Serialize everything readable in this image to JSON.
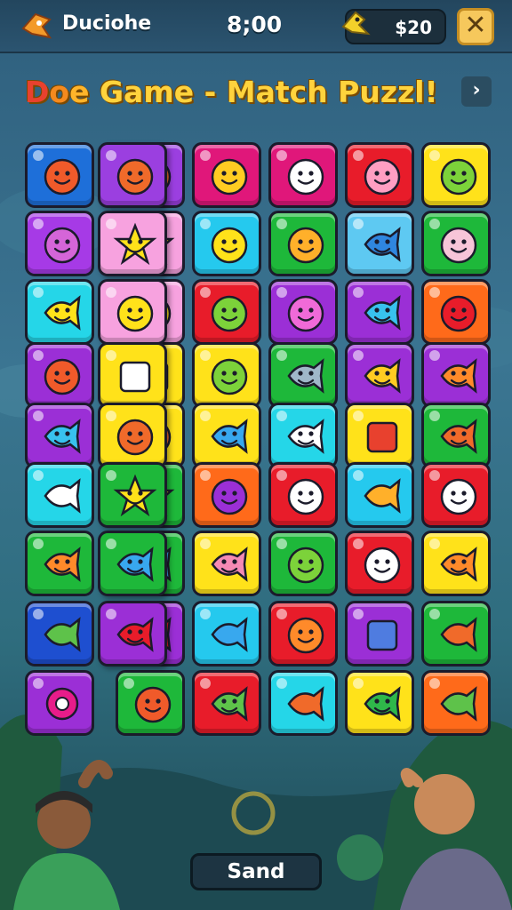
{
  "header": {
    "app_title": "Duciohe",
    "timer": "8;00",
    "coins": "$20",
    "close_label": "✕"
  },
  "banner": {
    "title_prefix_letters": [
      "D",
      "o",
      "e"
    ],
    "title_rest": " Game - Match Puzzl!",
    "next_label": "›"
  },
  "board": {
    "tiles": [
      {
        "color": "#1e6fd9",
        "face": "#f05a2a",
        "icon": "orange-face-icon"
      },
      {
        "color": "#9b3fe0",
        "face": "#f06a2a",
        "icon": "orange-blob-icon"
      },
      {
        "color": "#e0177a",
        "face": "#ffcc22",
        "icon": "yellow-face-icon"
      },
      {
        "color": "#e0177a",
        "face": "#ffffff",
        "icon": "white-face-icon"
      },
      {
        "color": "#e81c2a",
        "face": "#ff9ec2",
        "icon": "pink-face-icon"
      },
      {
        "color": "#ffe21a",
        "face": "#7cd23a",
        "icon": "green-face-icon"
      },
      {
        "color": "#a63ae6",
        "face": "#d565d8",
        "icon": "purple-cat-icon"
      },
      {
        "color": "#f7a2df",
        "face": "#ffe21a",
        "icon": "yellow-star-icon"
      },
      {
        "color": "#25c9ee",
        "face": "#ffe21a",
        "icon": "lemon-icon"
      },
      {
        "color": "#1eb83a",
        "face": "#ffb02a",
        "icon": "orange-swirl-icon"
      },
      {
        "color": "#5ec9f2",
        "face": "#2f86df",
        "icon": "blue-fish-icon"
      },
      {
        "color": "#1eb83a",
        "face": "#f7c5d8",
        "icon": "pink-squid-icon"
      },
      {
        "color": "#25d6e8",
        "face": "#ffe21a",
        "icon": "yellow-bird-icon"
      },
      {
        "color": "#f7a2df",
        "face": "#ffe21a",
        "icon": "yellow-cat-icon"
      },
      {
        "color": "#e81c2a",
        "face": "#7cd23a",
        "icon": "green-face-icon"
      },
      {
        "color": "#9b2fd6",
        "face": "#f06ad8",
        "icon": "pink-heart-icon"
      },
      {
        "color": "#9b2fd6",
        "face": "#38c2ee",
        "icon": "cyan-fish-icon"
      },
      {
        "color": "#ff6a1a",
        "face": "#e81c2a",
        "icon": "red-mushroom-icon"
      },
      {
        "color": "#9b2fd6",
        "face": "#f05a2a",
        "icon": "orange-crab-icon"
      },
      {
        "color": "#ffe21a",
        "face": "#ffffff",
        "icon": "castle-icon"
      },
      {
        "color": "#ffe21a",
        "face": "#7cd23a",
        "icon": "green-drop-icon"
      },
      {
        "color": "#1eb83a",
        "face": "#9fb7c9",
        "icon": "grey-fish-icon"
      },
      {
        "color": "#9b2fd6",
        "face": "#ffcc22",
        "icon": "yellow-fish-icon"
      },
      {
        "color": "#9b2fd6",
        "face": "#ff8a2a",
        "icon": "orange-fish-icon"
      },
      {
        "color": "#9b2fd6",
        "face": "#38c2ee",
        "icon": "blue-bird-icon"
      },
      {
        "color": "#ffe21a",
        "face": "#f06a2a",
        "icon": "orange-cat-icon"
      },
      {
        "color": "#ffe21a",
        "face": "#38a8ee",
        "icon": "blue-fish-icon"
      },
      {
        "color": "#25d6e8",
        "face": "#ffffff",
        "icon": "white-fish-icon"
      },
      {
        "color": "#ffe21a",
        "face": "#e8412e",
        "icon": "cake-icon"
      },
      {
        "color": "#1eb83a",
        "face": "#f06a2a",
        "icon": "orange-fish-icon"
      },
      {
        "color": "#25d6e8",
        "face": "#ffffff",
        "icon": "paper-plane-icon"
      },
      {
        "color": "#1eb83a",
        "face": "#ffe21a",
        "icon": "yellow-star-icon"
      },
      {
        "color": "#ff6a1a",
        "face": "#9b2fd6",
        "icon": "purple-blob-icon"
      },
      {
        "color": "#e81c2a",
        "face": "#ffffff",
        "icon": "white-face-icon"
      },
      {
        "color": "#25c9ee",
        "face": "#ffb02a",
        "icon": "bandage-icon"
      },
      {
        "color": "#e81c2a",
        "face": "#ffffff",
        "icon": "white-face-icon"
      },
      {
        "color": "#1eb83a",
        "face": "#ff8a2a",
        "icon": "orange-fish-icon"
      },
      {
        "color": "#1eb83a",
        "face": "#38a8ee",
        "icon": "blue-fish-icon"
      },
      {
        "color": "#ffe21a",
        "face": "#f58ab4",
        "icon": "pink-fish-icon"
      },
      {
        "color": "#1eb83a",
        "face": "#7cd23a",
        "icon": "green-frog-icon"
      },
      {
        "color": "#e81c2a",
        "face": "#ffffff",
        "icon": "white-ghost-icon"
      },
      {
        "color": "#ffe21a",
        "face": "#ff8a2a",
        "icon": "orange-fish-icon"
      },
      {
        "color": "#1e4fd0",
        "face": "#5ec24a",
        "icon": "green-leaf-icon"
      },
      {
        "color": "#9b2fd6",
        "face": "#e81c2a",
        "icon": "red-bird-icon"
      },
      {
        "color": "#25c9ee",
        "face": "#38a8ee",
        "icon": "blue-shoe-icon"
      },
      {
        "color": "#e81c2a",
        "face": "#ff8a2a",
        "icon": "orange-face-icon"
      },
      {
        "color": "#9b2fd6",
        "face": "#4f7ce0",
        "icon": "blue-square-icon"
      },
      {
        "color": "#1eb83a",
        "face": "#f06a2a",
        "icon": "orange-flag-icon"
      },
      {
        "color": "#9b2fd6",
        "face": "#e81c8a",
        "icon": "pink-ring-icon"
      },
      {
        "color": "#1eb83a",
        "face": "#f05a2a",
        "icon": "orange-crab-icon"
      },
      {
        "color": "#e81c2a",
        "face": "#5ec24a",
        "icon": "green-lizard-icon"
      },
      {
        "color": "#25d6e8",
        "face": "#f06a2a",
        "icon": "orange-shard-icon"
      },
      {
        "color": "#ffe21a",
        "face": "#2fb84a",
        "icon": "green-fish-icon"
      },
      {
        "color": "#ff6a1a",
        "face": "#5ec24a",
        "icon": "green-pickle-icon"
      }
    ],
    "overlay_tiles": [
      {
        "color": "#9b3fe0",
        "face": "#f06a2a",
        "icon": "orange-blob-icon"
      },
      {
        "color": "#f7a2df",
        "face": "#ffe21a",
        "icon": "yellow-star-icon"
      },
      {
        "color": "#f7a2df",
        "face": "#ffe21a",
        "icon": "yellow-cat-icon"
      },
      {
        "color": "#ffe21a",
        "face": "#ffffff",
        "icon": "castle-icon"
      },
      {
        "color": "#ffe21a",
        "face": "#f06a2a",
        "icon": "orange-cat-icon"
      },
      {
        "color": "#1eb83a",
        "face": "#ffe21a",
        "icon": "yellow-star-icon"
      },
      {
        "color": "#1eb83a",
        "face": "#38a8ee",
        "icon": "blue-fish-icon"
      },
      {
        "color": "#9b2fd6",
        "face": "#e81c2a",
        "icon": "red-bird-icon"
      }
    ]
  },
  "footer": {
    "button_label": "Sand"
  }
}
